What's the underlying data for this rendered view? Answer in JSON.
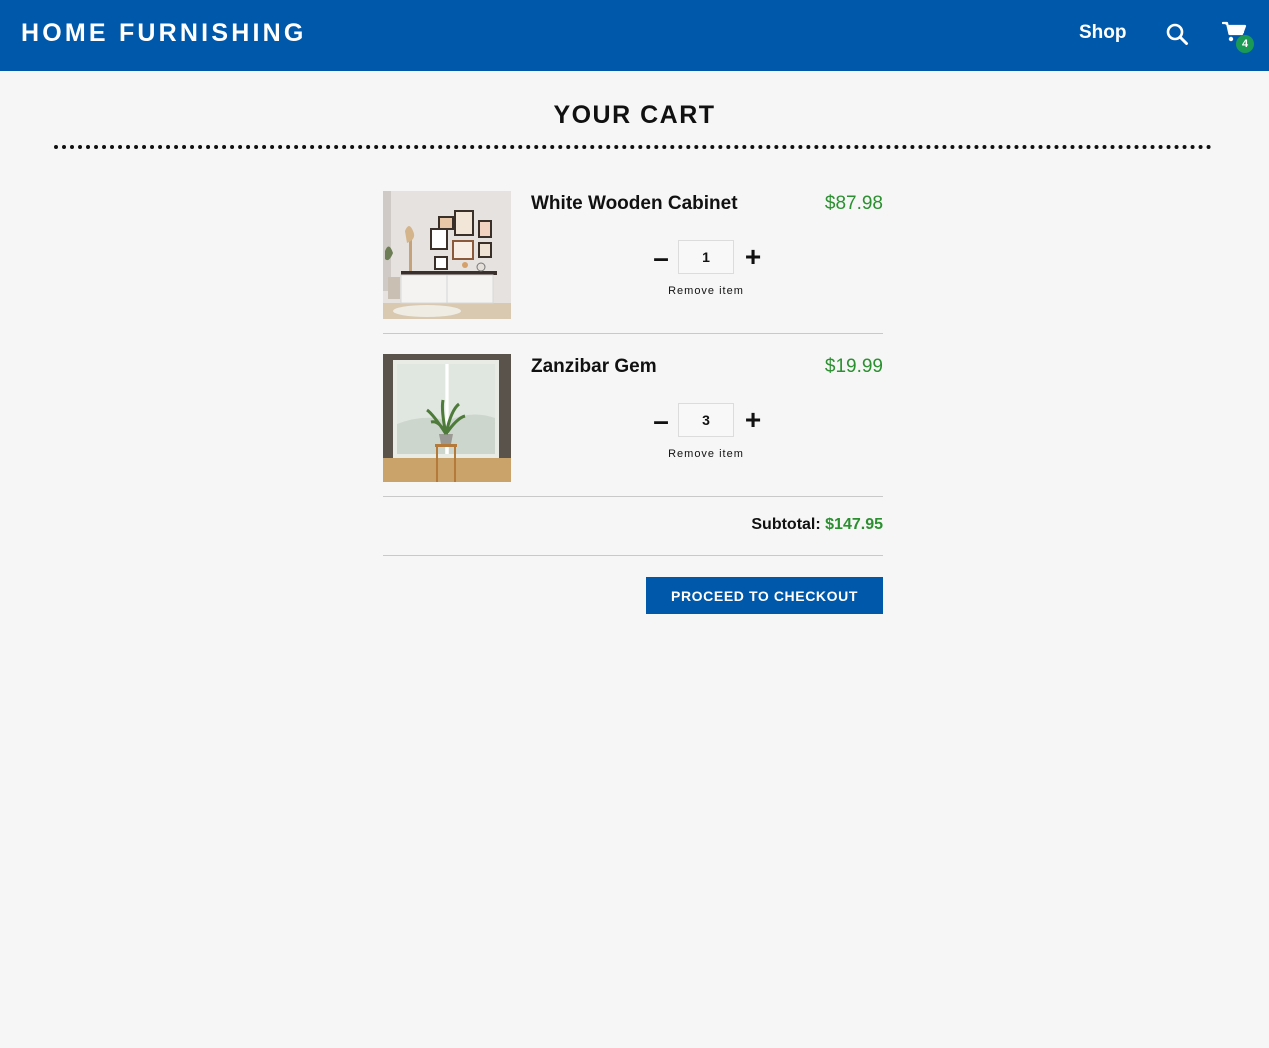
{
  "header": {
    "brand": "HOME FURNISHING",
    "nav_shop": "Shop",
    "search_icon": "search-icon",
    "cart_icon": "cart-icon",
    "cart_count": "4"
  },
  "page": {
    "title": "YOUR CART"
  },
  "cart": {
    "items": [
      {
        "name": "White Wooden Cabinet",
        "price": "$87.98",
        "quantity": "1",
        "minus_label": "–",
        "plus_label": "+",
        "remove_label": "Remove item"
      },
      {
        "name": "Zanzibar Gem",
        "price": "$19.99",
        "quantity": "3",
        "minus_label": "–",
        "plus_label": "+",
        "remove_label": "Remove item"
      }
    ],
    "subtotal_label": "Subtotal:",
    "subtotal_value": "$147.95",
    "checkout_label": "PROCEED TO CHECKOUT"
  },
  "colors": {
    "brand_blue": "#0058ab",
    "price_green": "#2b9030",
    "badge_green": "#1a9a55",
    "background": "#f6f6f6"
  }
}
